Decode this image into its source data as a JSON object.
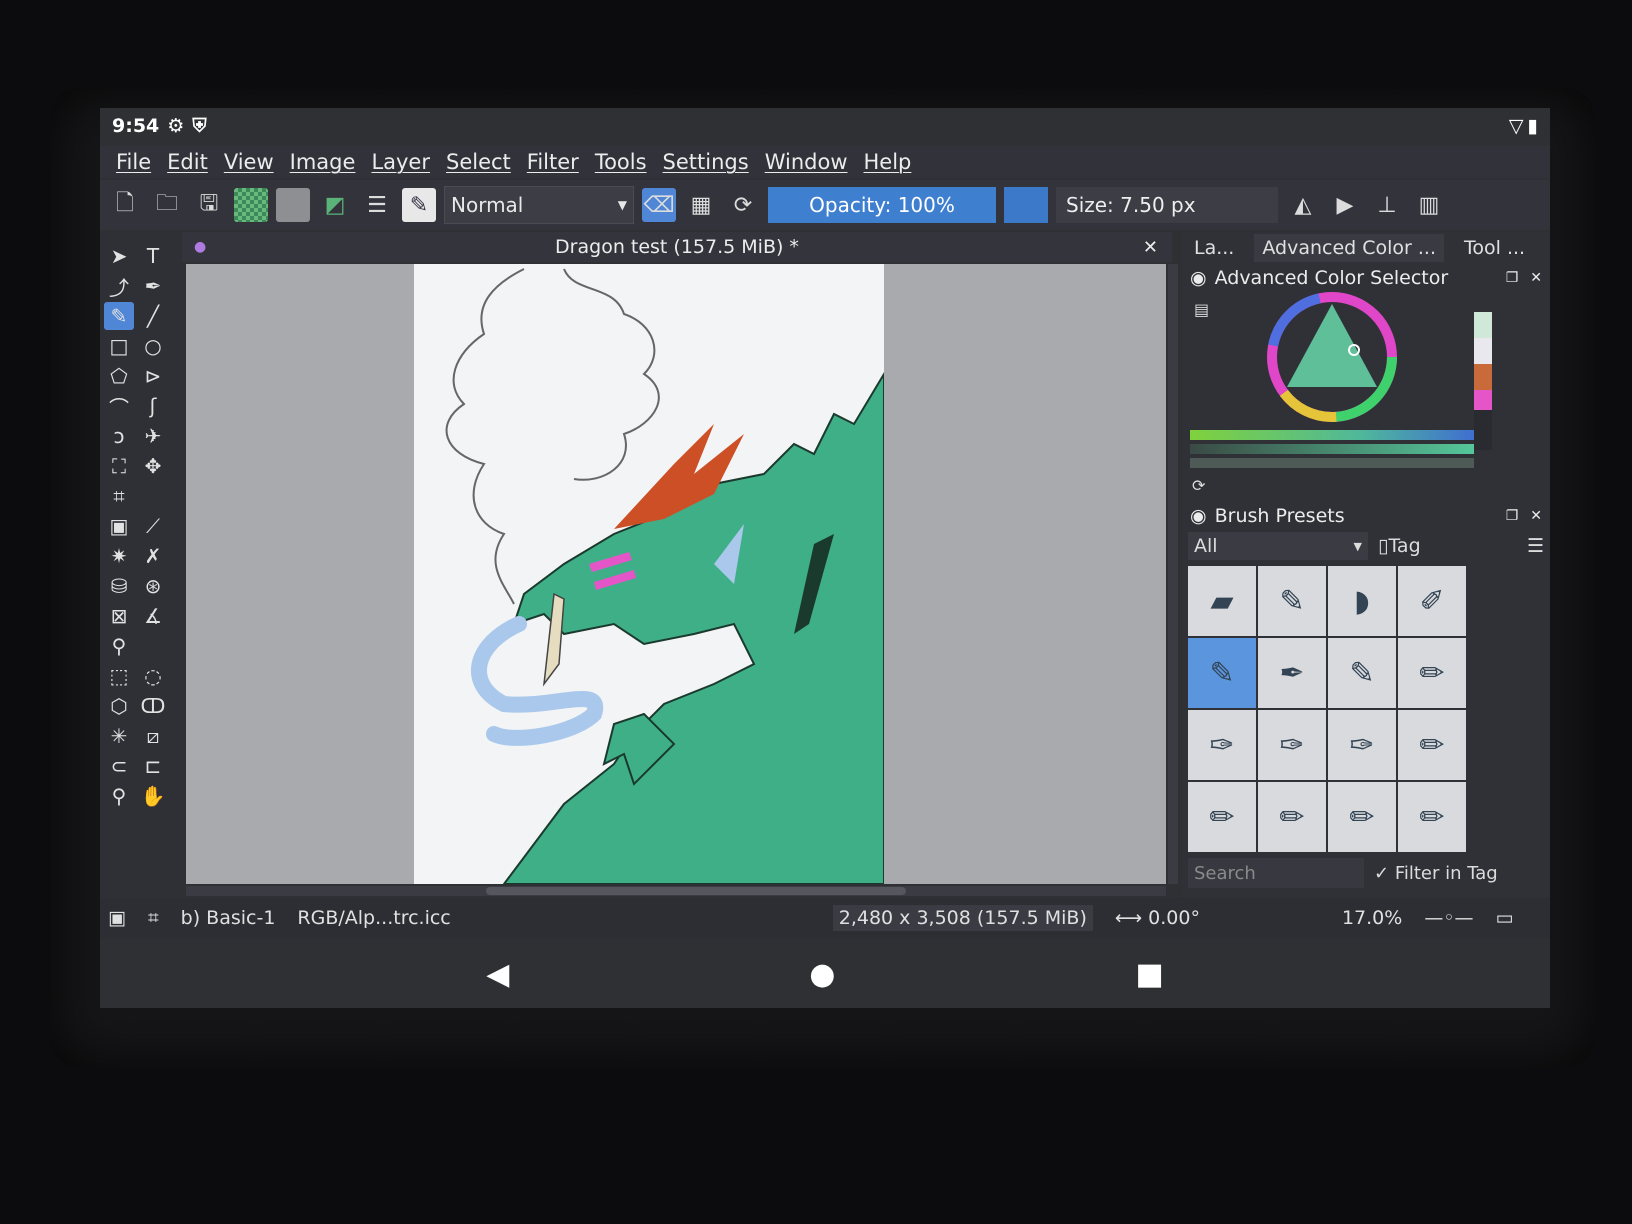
{
  "status_bar": {
    "time": "9:54"
  },
  "menu": [
    "File",
    "Edit",
    "View",
    "Image",
    "Layer",
    "Select",
    "Filter",
    "Tools",
    "Settings",
    "Window",
    "Help"
  ],
  "toolbar": {
    "blend_mode": "Normal",
    "opacity_label": "Opacity: 100%",
    "opacity_value": 100,
    "size_label": "Size: 7.50 px",
    "size_value": 7.5,
    "foreground_color": "#3c79c8"
  },
  "document": {
    "title": "Dragon test (157.5 MiB) *",
    "canvas_bg": "#a9aaae",
    "paper_color": "#f2f4f5"
  },
  "dockers": {
    "tabs": [
      "La...",
      "Advanced Color ...",
      "Tool ..."
    ],
    "color_selector_title": "Advanced Color Selector",
    "brush_presets_title": "Brush Presets",
    "preset_filter": "All",
    "tag_label": "Tag",
    "search_placeholder": "Search",
    "filter_in_tag": "Filter in Tag"
  },
  "app_status": {
    "brush": "b) Basic-1",
    "color_profile": "RGB/Alp...trc.icc",
    "dimensions": "2,480 x 3,508 (157.5 MiB)",
    "rotation": "0.00°",
    "zoom": "17.0%"
  },
  "colors": {
    "accent": "#4f86d6",
    "dragon_green": "#3faf88",
    "flame_orange": "#cd4f26",
    "tongue_blue": "#a9c8ec",
    "spot_pink": "#e456c8"
  }
}
